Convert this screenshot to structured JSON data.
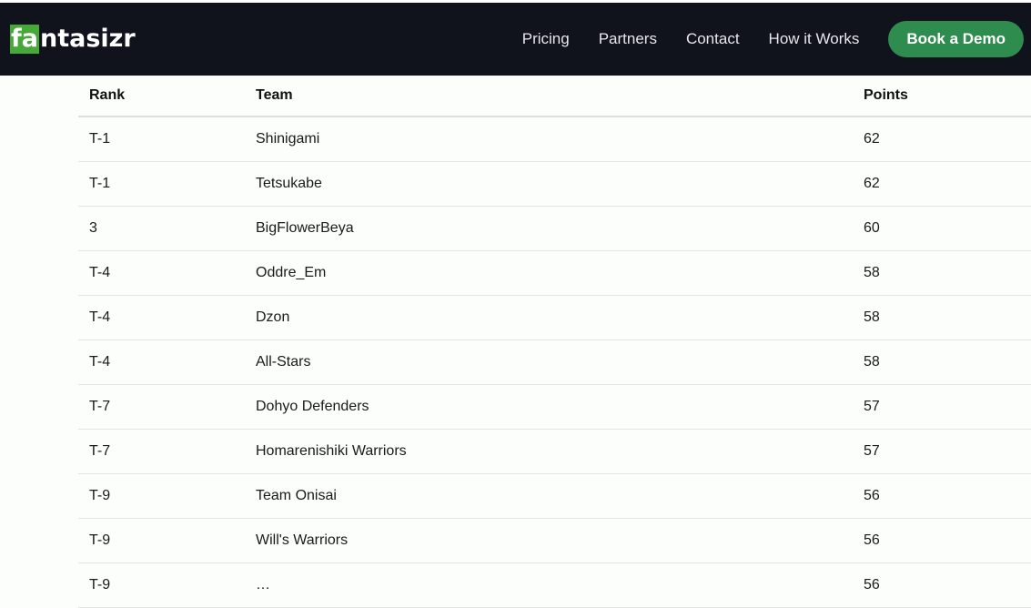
{
  "brand": {
    "logo_highlight": "fa",
    "logo_rest": "ntasizr",
    "highlight_color": "#47a83a"
  },
  "nav": {
    "links": [
      {
        "label": "Pricing"
      },
      {
        "label": "Partners"
      },
      {
        "label": "Contact"
      },
      {
        "label": "How it Works"
      }
    ],
    "cta_label": "Book a Demo"
  },
  "table": {
    "headers": {
      "rank": "Rank",
      "team": "Team",
      "points": "Points"
    },
    "rows": [
      {
        "rank": "T-1",
        "team": "Shinigami",
        "points": "62"
      },
      {
        "rank": "T-1",
        "team": "Tetsukabe",
        "points": "62"
      },
      {
        "rank": "3",
        "team": "BigFlowerBeya",
        "points": "60"
      },
      {
        "rank": "T-4",
        "team": "Oddre_Em",
        "points": "58"
      },
      {
        "rank": "T-4",
        "team": "Dzon",
        "points": "58"
      },
      {
        "rank": "T-4",
        "team": "All-Stars",
        "points": "58"
      },
      {
        "rank": "T-7",
        "team": "Dohyo Defenders",
        "points": "57"
      },
      {
        "rank": "T-7",
        "team": "Homarenishiki Warriors",
        "points": "57"
      },
      {
        "rank": "T-9",
        "team": "Team Onisai",
        "points": "56"
      },
      {
        "rank": "T-9",
        "team": "Will's Warriors",
        "points": "56"
      },
      {
        "rank": "T-9",
        "team": "…",
        "points": "56"
      }
    ]
  }
}
